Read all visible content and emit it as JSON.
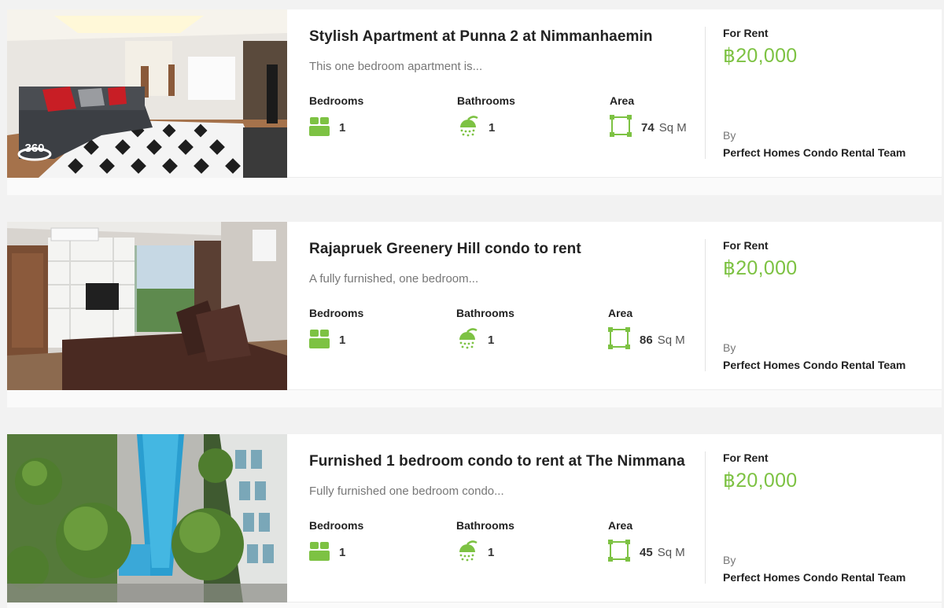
{
  "colors": {
    "accent": "#7dc243",
    "text": "#222222",
    "muted": "#777777"
  },
  "features_labels": {
    "bedrooms": "Bedrooms",
    "bathrooms": "Bathrooms",
    "area": "Area"
  },
  "listings": [
    {
      "title": "Stylish Apartment at Punna 2 at Nimmanhaemin",
      "excerpt": "This one bedroom apartment is...",
      "bedrooms": "1",
      "bathrooms": "1",
      "area_value": "74",
      "area_unit": "Sq M",
      "status": "For Rent",
      "price": "฿20,000",
      "by_label": "By",
      "agent": "Perfect Homes Condo Rental Team",
      "badge": "360",
      "photo": "living-room-white-black-rug"
    },
    {
      "title": "Rajapruek Greenery Hill condo to rent",
      "excerpt": "A fully furnished, one bedroom...",
      "bedrooms": "1",
      "bathrooms": "1",
      "area_value": "86",
      "area_unit": "Sq M",
      "status": "For Rent",
      "price": "฿20,000",
      "by_label": "By",
      "agent": "Perfect Homes Condo Rental Team",
      "photo": "living-room-leather-sofa"
    },
    {
      "title": "Furnished 1 bedroom condo to rent at The Nimmana",
      "excerpt": "Fully furnished one  bedroom condo...",
      "bedrooms": "1",
      "bathrooms": "1",
      "area_value": "45",
      "area_unit": "Sq M",
      "status": "For Rent",
      "price": "฿20,000",
      "by_label": "By",
      "agent": "Perfect Homes Condo Rental Team",
      "photo": "aerial-pool-garden"
    }
  ]
}
